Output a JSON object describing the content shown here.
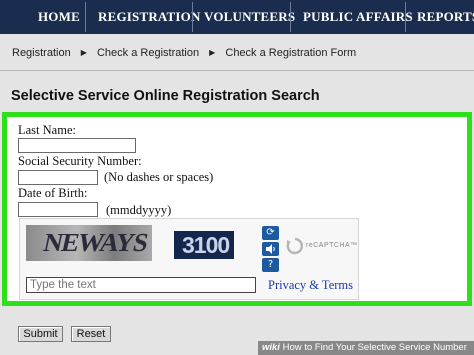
{
  "nav": {
    "items": [
      "HOME",
      "REGISTRATION",
      "VOLUNTEERS",
      "PUBLIC AFFAIRS",
      "REPORTS"
    ]
  },
  "breadcrumb": [
    "Registration",
    "Check a Registration",
    "Check a Registration Form"
  ],
  "page_title": "Selective Service Online Registration Search",
  "form": {
    "last_name_label": "Last Name:",
    "last_name_value": "",
    "ssn_label": "Social Security Number:",
    "ssn_value": "",
    "ssn_hint": "(No dashes or spaces)",
    "dob_label": "Date of Birth:",
    "dob_value": "",
    "dob_hint": "(mmddyyyy)"
  },
  "captcha": {
    "word1": "NEWAYS",
    "word2": "3100",
    "refresh_icon": "refresh-icon",
    "audio_icon": "audio-icon",
    "help_icon": "help-icon",
    "logo_text": "reCAPTCHA™",
    "input_placeholder": "Type the text",
    "privacy_link": "Privacy & Terms"
  },
  "buttons": {
    "submit": "Submit",
    "reset": "Reset"
  },
  "watermark": {
    "brand": "wiki",
    "text": "How to Find Your Selective Service Number"
  },
  "colors": {
    "nav_bg": "#1b2d4f",
    "highlight": "#2ee019",
    "link": "#1b3aa8"
  }
}
